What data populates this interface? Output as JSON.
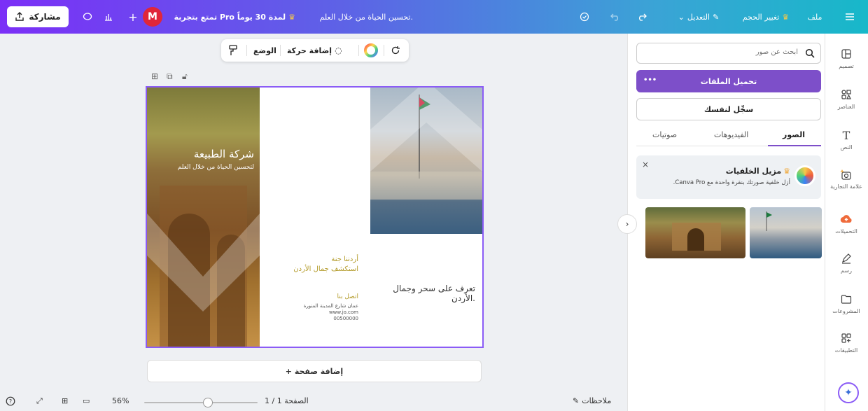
{
  "topbar": {
    "menu_icon": "hamburger-icon",
    "file_label": "ملف",
    "resize_label": "تغيير الحجم",
    "edit_label": "التعديل",
    "design_title": "تحسين الحياة من خلال العلم.",
    "pro_trial_label": "تمتع بتجربة Pro لمدة 30 يوماً",
    "avatar_letter": "M",
    "share_label": "مشاركة"
  },
  "floating_toolbar": {
    "position_label": "الوضع",
    "animate_label": "إضافة حركة"
  },
  "design": {
    "brand_title": "شركة الطبيعة",
    "brand_subtitle": "لتحسين الحياة من خلال العلم",
    "tagline_1": "أردننا جنة",
    "tagline_2": "استكشف جمال الأردن",
    "contact_heading": "اتصل بنا",
    "contact_address": "عمان شارع المدينة المنورة",
    "contact_web": "www.jo.com",
    "contact_phone": "00500000",
    "headline": "تعرف على سحر وجمال الأردن."
  },
  "canvas": {
    "add_page_label": "+ إضافة صفحة"
  },
  "bottombar": {
    "notes_label": "ملاحظات",
    "page_indicator": "الصفحة 1 / 1",
    "zoom_level": "56%",
    "zoom_fraction": 0.56
  },
  "panel": {
    "search_placeholder": "ابحث عن صور",
    "upload_label": "تحميل الملفات",
    "upload_more": "•••",
    "register_label": "سجِّل لنفسك",
    "tabs": [
      "الصور",
      "الفيديوهات",
      "صوتيات"
    ],
    "promo_title": "مزيل الخلفيات",
    "promo_text": "أزل خلفية صورتك بنقرة واحدة مع Canva Pro.",
    "collapse_icon": "chevron-right-icon"
  },
  "rail": {
    "items": [
      {
        "label": "تصميم",
        "icon": "layout-icon"
      },
      {
        "label": "العناصر",
        "icon": "elements-icon"
      },
      {
        "label": "النص",
        "icon": "text-icon"
      },
      {
        "label": "علامة التجارية",
        "icon": "brand-icon"
      },
      {
        "label": "التحميلات",
        "icon": "cloud-upload-icon"
      },
      {
        "label": "رسم",
        "icon": "draw-icon"
      },
      {
        "label": "المشروعات",
        "icon": "folder-icon"
      },
      {
        "label": "التطبيقات",
        "icon": "apps-icon"
      }
    ]
  },
  "colors": {
    "accent_purple": "#7d4fc9",
    "avatar_red": "#e0263a",
    "selection": "#8b5cf6"
  }
}
